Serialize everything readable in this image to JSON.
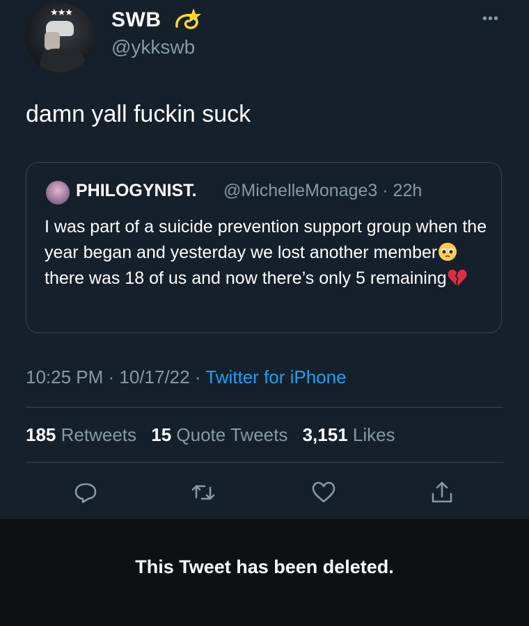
{
  "author": {
    "name": "SWB",
    "handle": "@ykkswb",
    "avatar_icon": "profile-photo",
    "name_emoji": "dizzy-star-emoji"
  },
  "tweet": {
    "text": "damn yall fuckin suck"
  },
  "quoted_tweet": {
    "name": "PHILOGYNIST.",
    "handle_time": "@MichelleMonage3 · 22h",
    "text_parts": [
      "I was part of a suicide prevention support group when the year began and yesterday we lost another member",
      " there was 18 of us and now there’s only 5 remaining"
    ],
    "emojis": [
      "pleading-face-emoji",
      "broken-heart-emoji"
    ]
  },
  "meta": {
    "time_date": "10:25 PM · 10/17/22 · ",
    "source": "Twitter for iPhone"
  },
  "stats": {
    "retweets_count": "185",
    "retweets_label": "Retweets",
    "quotes_count": "15",
    "quotes_label": "Quote Tweets",
    "likes_count": "3,151",
    "likes_label": "Likes"
  },
  "actions": [
    "reply-icon",
    "retweet-icon",
    "like-icon",
    "share-icon"
  ],
  "notice": {
    "text": "This Tweet has been deleted."
  },
  "colors": {
    "background": "#15202b",
    "secondary_text": "#8899a6",
    "link": "#1da1f2",
    "border": "#38444d",
    "deleted_bar": "#0e1114"
  }
}
